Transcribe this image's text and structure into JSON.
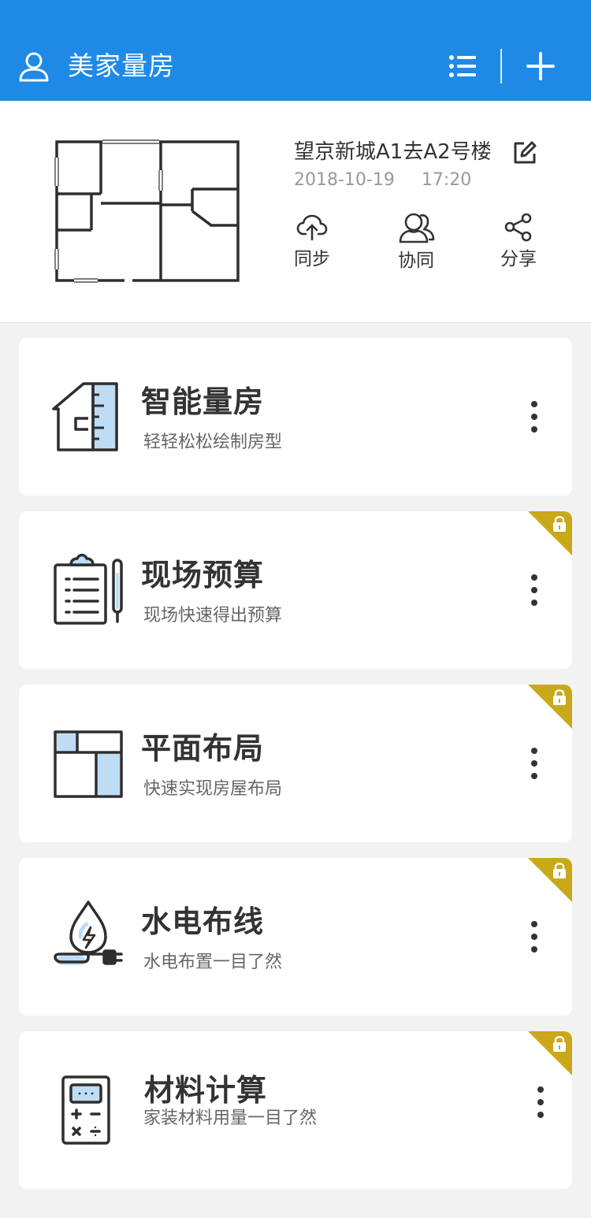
{
  "header": {
    "title": "美家量房",
    "icons": {
      "user": "user-icon",
      "list": "list-icon",
      "add": "plus-icon"
    }
  },
  "project": {
    "name": "望京新城A1去A2号楼",
    "date": "2018-10-19",
    "time": "17:20",
    "actions": [
      {
        "label": "同步",
        "icon": "cloud-upload-icon"
      },
      {
        "label": "协同",
        "icon": "users-icon"
      },
      {
        "label": "分享",
        "icon": "share-icon"
      }
    ]
  },
  "cards": [
    {
      "title": "智能量房",
      "subtitle": "轻轻松松绘制房型",
      "icon": "house-ruler-icon",
      "locked": false
    },
    {
      "title": "现场预算",
      "subtitle": "现场快速得出预算",
      "icon": "clipboard-pen-icon",
      "locked": true
    },
    {
      "title": "平面布局",
      "subtitle": "快速实现房屋布局",
      "icon": "layout-icon",
      "locked": true
    },
    {
      "title": "水电布线",
      "subtitle": "水电布置一目了然",
      "icon": "water-power-icon",
      "locked": true
    },
    {
      "title": "材料计算",
      "subtitle": "家装材料用量一目了然",
      "icon": "calculator-icon",
      "locked": true
    }
  ],
  "colors": {
    "primary": "#1e8ae6",
    "accent_light": "#bfdcf5",
    "lock_badge": "#c9a81a",
    "background": "#f2f2f2"
  }
}
